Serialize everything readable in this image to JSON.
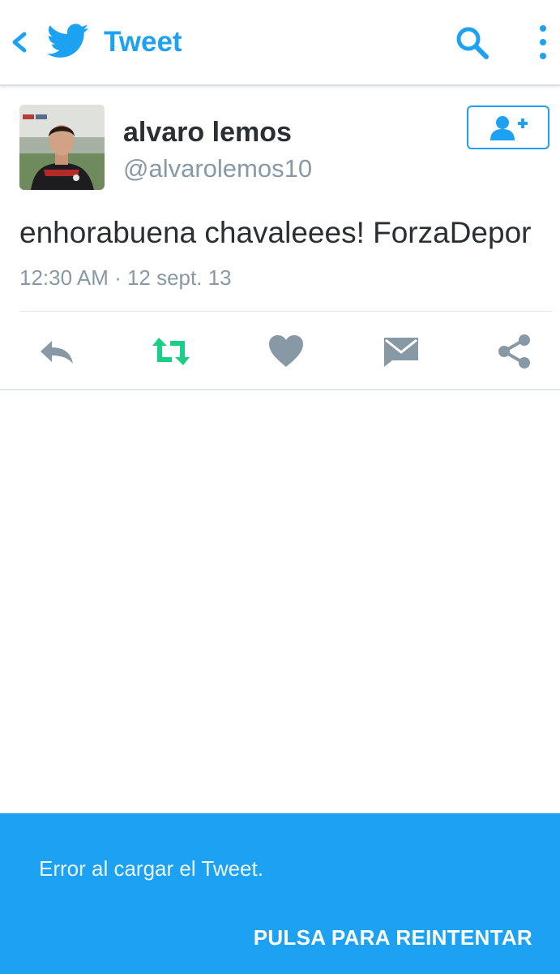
{
  "header": {
    "title": "Tweet",
    "back_icon": "chevron-left-icon",
    "logo_icon": "twitter-bird-icon",
    "search_icon": "search-icon",
    "more_icon": "more-vertical-icon",
    "accent_color": "#1da1f2"
  },
  "tweet": {
    "user_name": "alvaro lemos",
    "handle": "@alvarolemos10",
    "text": "enhorabuena chavaleees! ForzaDepor",
    "meta": "12:30 AM · 12 sept. 13",
    "follow_icon": "add-user-icon"
  },
  "actions": [
    {
      "name": "reply",
      "icon": "reply-icon"
    },
    {
      "name": "retweet",
      "icon": "retweet-icon",
      "color": "#19cf86"
    },
    {
      "name": "like",
      "icon": "heart-icon"
    },
    {
      "name": "direct-message",
      "icon": "mail-icon"
    },
    {
      "name": "share",
      "icon": "share-icon"
    }
  ],
  "error": {
    "message": "Error al cargar el Tweet.",
    "retry_label": "PULSA PARA REINTENTAR",
    "background": "#1da1f2"
  }
}
